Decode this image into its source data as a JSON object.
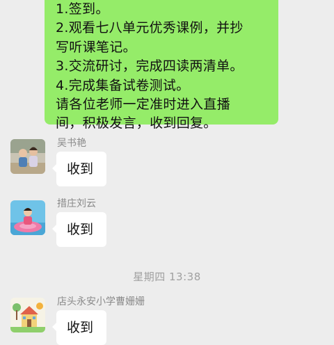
{
  "outgoing_message": {
    "lines": [
      "1.签到。",
      "2.观看七八单元优秀课例，并抄",
      "写听课笔记。",
      "3.交流研讨，完成四读两清单。",
      "4.完成集备试卷测试。",
      "请各位老师一定准时进入直播",
      "间，积极发言，收到回复。"
    ]
  },
  "messages": [
    {
      "sender": "吴书艳",
      "text": "收到",
      "avatar_icon": "children-photo-avatar"
    },
    {
      "sender": "措庄刘云",
      "text": "收到",
      "avatar_icon": "child-pink-float-avatar"
    },
    {
      "sender": "店头永安小学曹姗姗",
      "text": "收到",
      "avatar_icon": "cartoon-house-avatar"
    }
  ],
  "timestamp": "星期四 13:38",
  "colors": {
    "outgoing_bubble": "#95ec69",
    "background": "#ededed",
    "incoming_bubble": "#ffffff"
  }
}
